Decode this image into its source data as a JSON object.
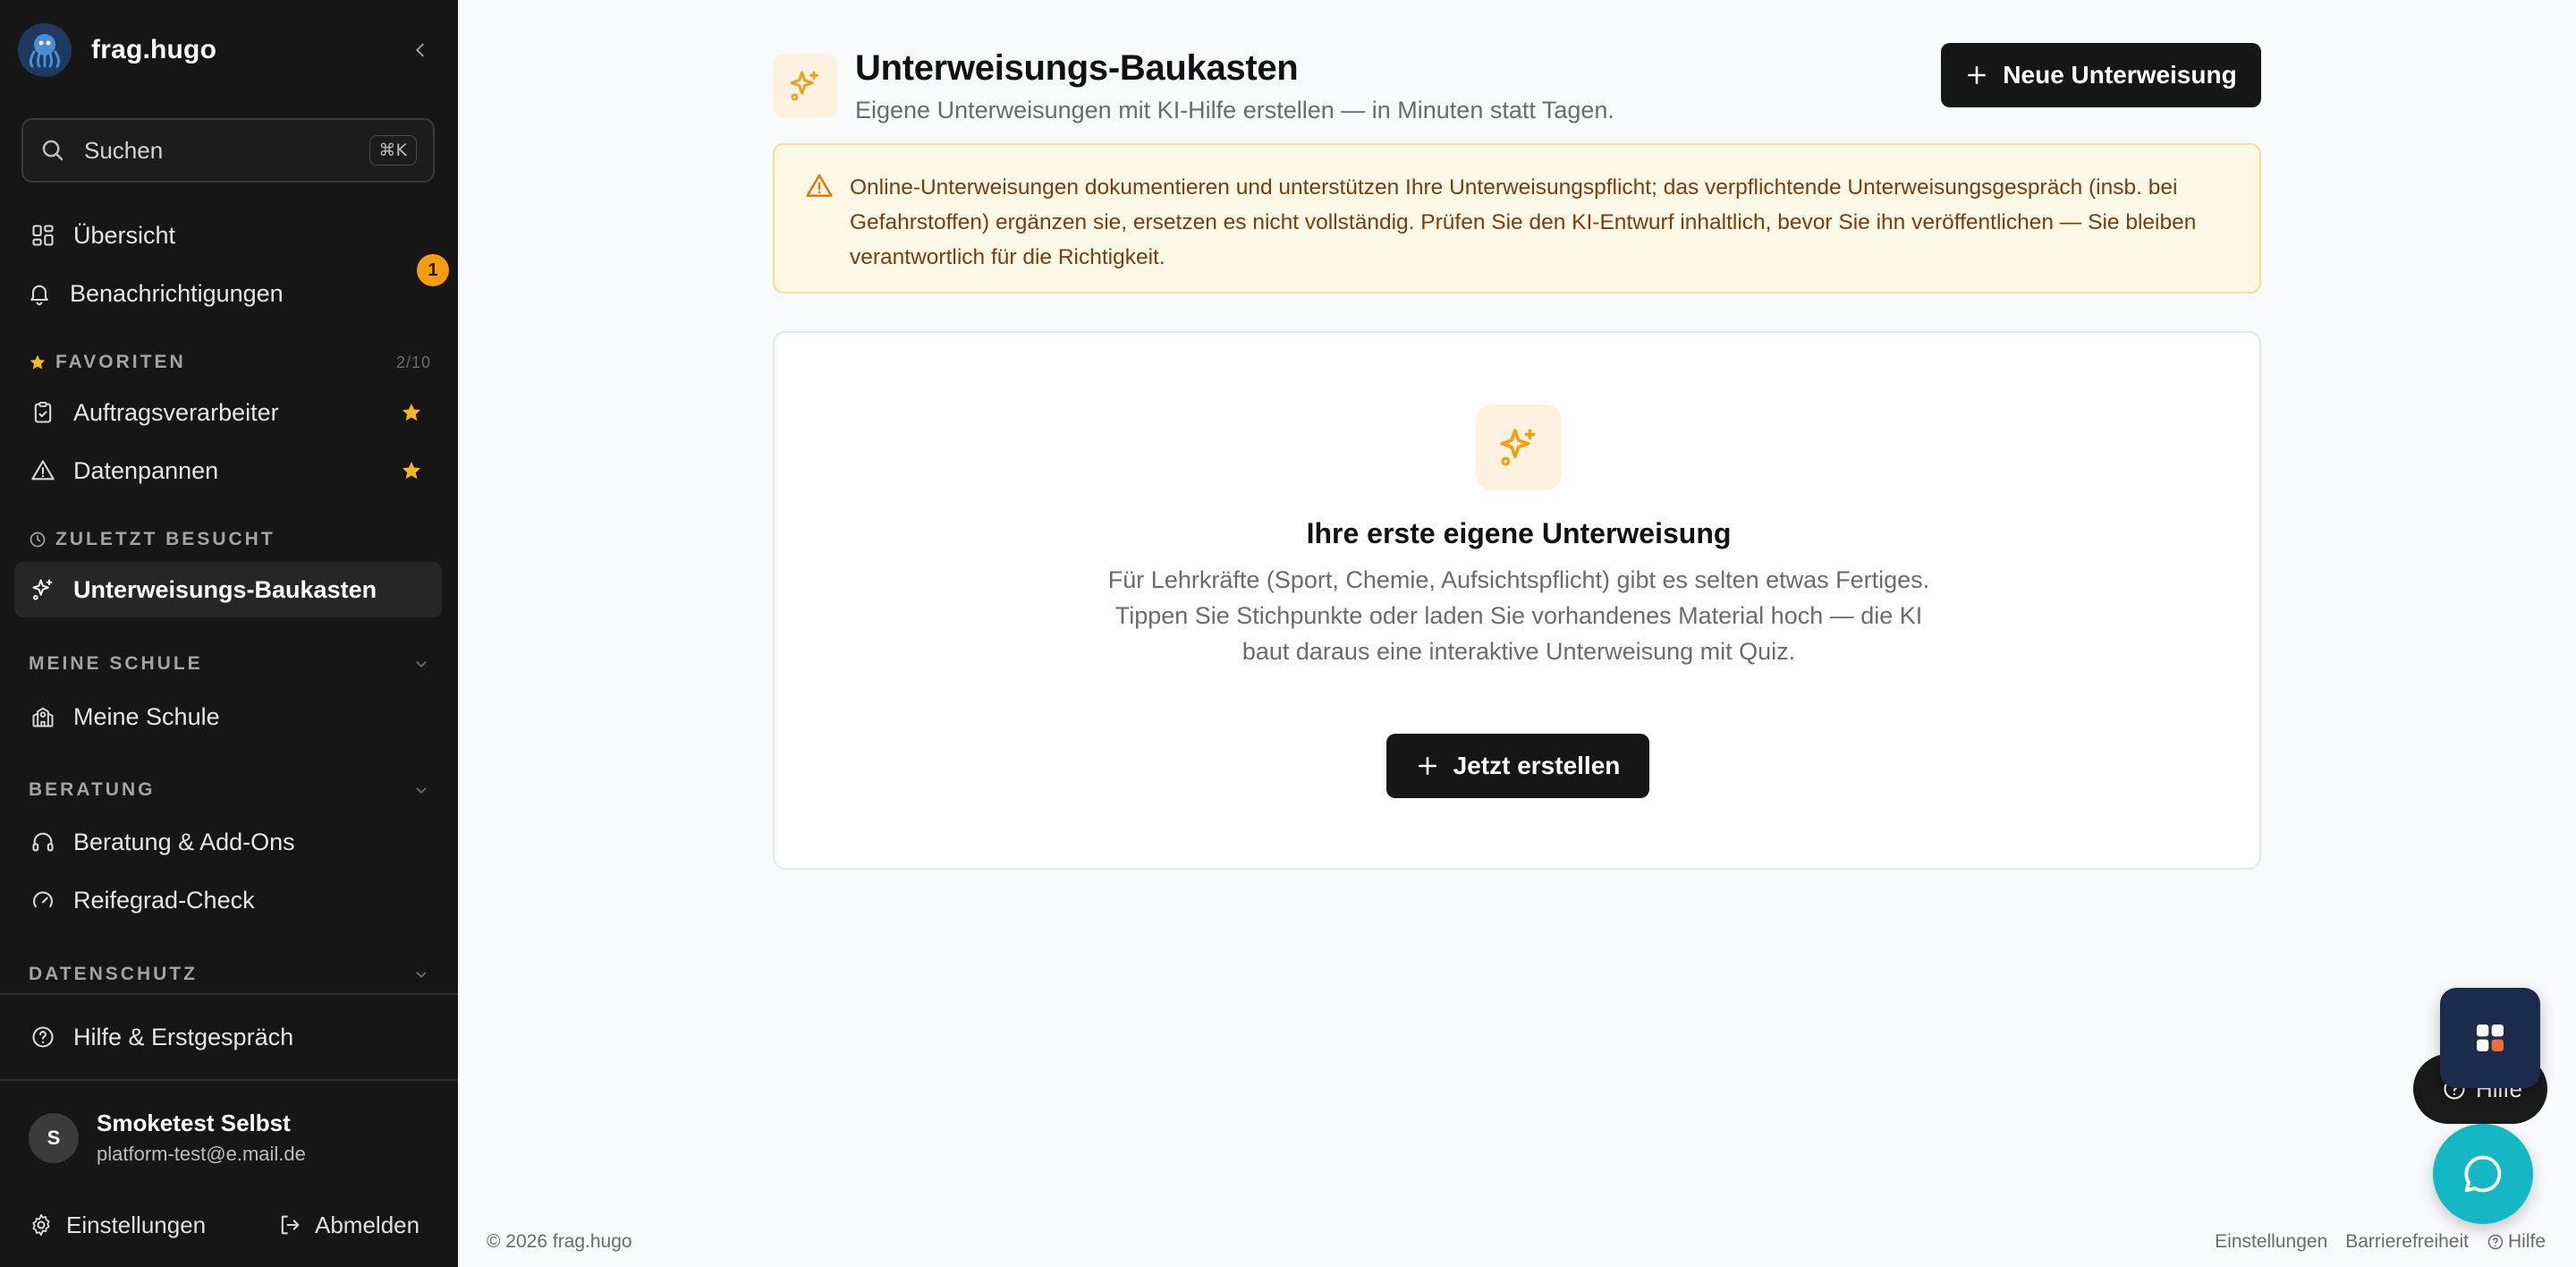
{
  "app": {
    "brand": "frag.hugo"
  },
  "sidebar": {
    "search": {
      "placeholder": "Suchen",
      "shortcut": "⌘K"
    },
    "top_items": [
      {
        "label": "Übersicht",
        "icon": "grid-icon"
      },
      {
        "label": "Benachrichtigungen",
        "icon": "bell-icon",
        "badge": "1"
      }
    ],
    "favorites": {
      "title": "FAVORITEN",
      "count": "2/10",
      "items": [
        {
          "label": "Auftragsverarbeiter",
          "icon": "clipboard-icon"
        },
        {
          "label": "Datenpannen",
          "icon": "warning-icon"
        }
      ]
    },
    "recent": {
      "title": "ZULETZT BESUCHT",
      "items": [
        {
          "label": "Unterweisungs-Baukasten",
          "icon": "sparkles-icon"
        }
      ]
    },
    "sections": [
      {
        "title": "MEINE SCHULE",
        "items": [
          {
            "label": "Meine Schule",
            "icon": "school-icon"
          }
        ]
      },
      {
        "title": "BERATUNG",
        "items": [
          {
            "label": "Beratung & Add-Ons",
            "icon": "headphones-icon"
          },
          {
            "label": "Reifegrad-Check",
            "icon": "gauge-icon"
          }
        ]
      },
      {
        "title": "DATENSCHUTZ",
        "items": []
      }
    ],
    "help_item": {
      "label": "Hilfe & Erstgespräch",
      "icon": "help-circle-icon"
    },
    "user": {
      "initial": "S",
      "name": "Smoketest Selbst",
      "email": "platform-test@e.mail.de"
    },
    "settings_label": "Einstellungen",
    "logout_label": "Abmelden"
  },
  "main": {
    "title": "Unterweisungs-Baukasten",
    "subtitle": "Eigene Unterweisungen mit KI-Hilfe erstellen — in Minuten statt Tagen.",
    "new_button": "Neue Unterweisung",
    "alert_text": "Online-Unterweisungen dokumentieren und unterstützen Ihre Unterweisungspflicht; das verpflichtende Unterweisungsgespräch (insb. bei Gefahrstoffen) ergänzen sie, ersetzen es nicht vollständig. Prüfen Sie den KI-Entwurf inhaltlich, bevor Sie ihn veröffentlichen — Sie bleiben verantwortlich für die Richtigkeit.",
    "empty_state": {
      "title": "Ihre erste eigene Unterweisung",
      "text": "Für Lehrkräfte (Sport, Chemie, Aufsichtspflicht) gibt es selten etwas Fertiges. Tippen Sie Stichpunkte oder laden Sie vorhandenes Material hoch — die KI baut daraus eine interaktive Unterweisung mit Quiz.",
      "button": "Jetzt erstellen"
    }
  },
  "footer": {
    "copyright": "© 2026 frag.hugo",
    "links": [
      "Einstellungen",
      "Barrierefreiheit",
      "Hilfe"
    ]
  },
  "floating": {
    "help_label": "Hilfe"
  },
  "colors": {
    "accent": "#f59e0b",
    "sidebar_bg": "#161616",
    "alert_bg": "#fef9e7",
    "chat": "#14b8c4"
  }
}
